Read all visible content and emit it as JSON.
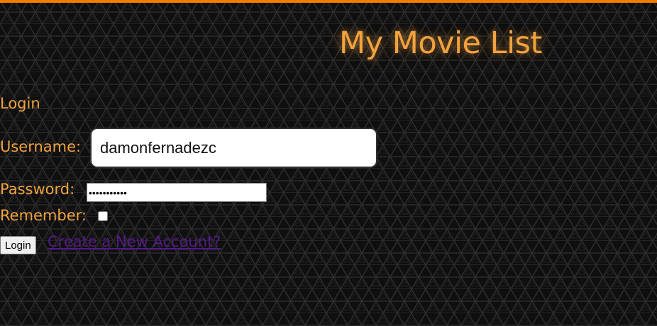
{
  "header": {
    "title": "My Movie List"
  },
  "login_form": {
    "heading": "Login",
    "username_label": "Username:",
    "username_value": "damonfernadezc",
    "password_label": "Password:",
    "password_value": "•••••••••••",
    "remember_label": "Remember:",
    "remember_checked": false,
    "login_button_label": "Login",
    "create_account_link": "Create a New Account?"
  },
  "colors": {
    "accent": "#f07c00",
    "text_orange": "#f2a23e",
    "link_visited": "#551a8b",
    "background": "#0f0f0f"
  }
}
